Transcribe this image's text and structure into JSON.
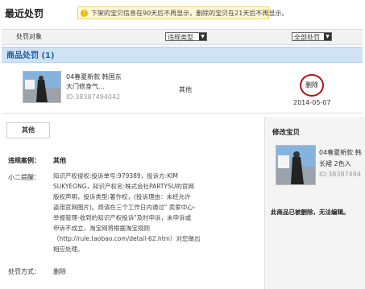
{
  "page": {
    "title": "最近处罚"
  },
  "notice": {
    "icon": "info-icon",
    "text": "下架的宝贝信息在90天后不再显示，删除的宝贝在21天后不再显示。"
  },
  "header": {
    "target_label": "处罚对象",
    "type_filter": "违规类型",
    "result_filter": "全部处罚"
  },
  "section": {
    "title": "商品处罚 (1)"
  },
  "item": {
    "title_line1": "04春夏新款  韩国东",
    "title_line2": "大门修身气...",
    "id": "ID:38387494042",
    "category": "其他",
    "action": "删除",
    "date": "2014-05-07"
  },
  "detail": {
    "tab": "其他",
    "case_label": "违规案例：",
    "case_value": "其他",
    "tip_label": "小二提醒：",
    "tip_lines": [
      "知识产权侵权:投诉单号:979389，投诉方:KIM",
      "SUKYEONG，知识产权名:株式会社PARTYSU的官网",
      "版权声明，投诉类型:著作权，(投诉理由：未经允许",
      "盗用官网图片)。烦请在三个工作日内通过\" 卖家中心-",
      "举报管理-收到的知识产权投诉\"及时申诉，未申诉或",
      "申诉不成立，淘宝网将根据淘宝规则",
      "（http://rule.taobao.com/detail-62.htm）对您做出",
      "相应处理。"
    ],
    "method_label": "处罚方式：",
    "method_value": "删除"
  },
  "modify": {
    "title": "修改宝贝",
    "item_line1": "04春夏新款  韩",
    "item_line2": "长裙 2色入",
    "item_id": "ID:38387494",
    "status": "此商品已被删除，无法编辑。"
  }
}
